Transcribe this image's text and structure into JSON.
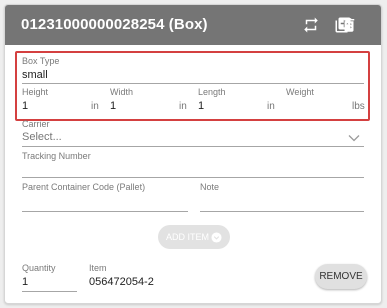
{
  "header": {
    "title": "01231000000028254 (Box)",
    "icons": [
      "swap-icon",
      "add-box-icon",
      "delete-icon"
    ]
  },
  "box": {
    "type_label": "Box Type",
    "type_value": "small",
    "height_label": "Height",
    "height_value": "1",
    "height_unit": "in",
    "width_label": "Width",
    "width_value": "1",
    "width_unit": "in",
    "length_label": "Length",
    "length_value": "1",
    "length_unit": "in",
    "weight_label": "Weight",
    "weight_value": "",
    "weight_unit": "lbs"
  },
  "carrier": {
    "label": "Carrier",
    "placeholder": "Select..."
  },
  "tracking": {
    "label": "Tracking Number",
    "value": ""
  },
  "parent_container": {
    "label": "Parent Container Code (Pallet)",
    "value": ""
  },
  "note": {
    "label": "Note",
    "value": ""
  },
  "add_item": {
    "label": "ADD ITEM"
  },
  "item": {
    "quantity_label": "Quantity",
    "quantity_value": "1",
    "item_label": "Item",
    "item_value": "056472054-2",
    "remove_label": "REMOVE"
  },
  "colors": {
    "header_bg": "#757575",
    "highlight_border": "#d44040"
  }
}
